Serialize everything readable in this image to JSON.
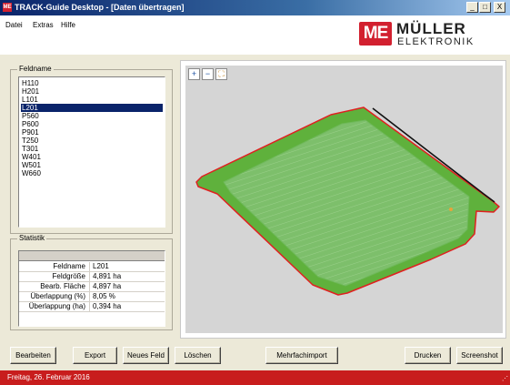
{
  "window": {
    "app_icon_label": "ME",
    "title": "TRACK-Guide Desktop - [Daten übertragen]",
    "controls": [
      "_",
      "□",
      "X"
    ]
  },
  "menu": [
    "Datei",
    "Extras",
    "Hilfe"
  ],
  "logo": {
    "box_text": "ME",
    "name": "MÜLLER",
    "sub": "ELEKTRONIK",
    "color": "#d2202f"
  },
  "fields": {
    "group_title": "Feldname",
    "items": [
      "H110",
      "H201",
      "L101",
      "L201",
      "P560",
      "P600",
      "P901",
      "T250",
      "T301",
      "W401",
      "W501",
      "W660"
    ],
    "selected": "L201"
  },
  "statistics": {
    "group_title": "Statistik",
    "rows": [
      {
        "label": "Feldname",
        "value": "L201"
      },
      {
        "label": "Feldgröße",
        "value": "4,891 ha"
      },
      {
        "label": "Bearb. Fläche",
        "value": "4,897 ha"
      },
      {
        "label": "Überlappung (%)",
        "value": "8,05 %"
      },
      {
        "label": "Überlappung (ha)",
        "value": "0,394 ha"
      }
    ]
  },
  "map": {
    "tools": [
      {
        "name": "zoom-in-icon",
        "glyph": "+"
      },
      {
        "name": "zoom-out-icon",
        "glyph": "−"
      },
      {
        "name": "zoom-fit-icon",
        "glyph": "⛶"
      }
    ],
    "colors": {
      "background": "#d5d5d5",
      "field_fill": "#7dbf6b",
      "headland": "#5fb13c",
      "boundary": "#e02020",
      "guidance_line": "#111111"
    }
  },
  "buttons": [
    "Bearbeiten",
    "Export",
    "Neues Feld",
    "Löschen",
    "Mehrfachimport",
    "Drucken",
    "Screenshot"
  ],
  "status": {
    "text": "Freitag, 26. Februar 2016",
    "color": "#c81d1d"
  }
}
